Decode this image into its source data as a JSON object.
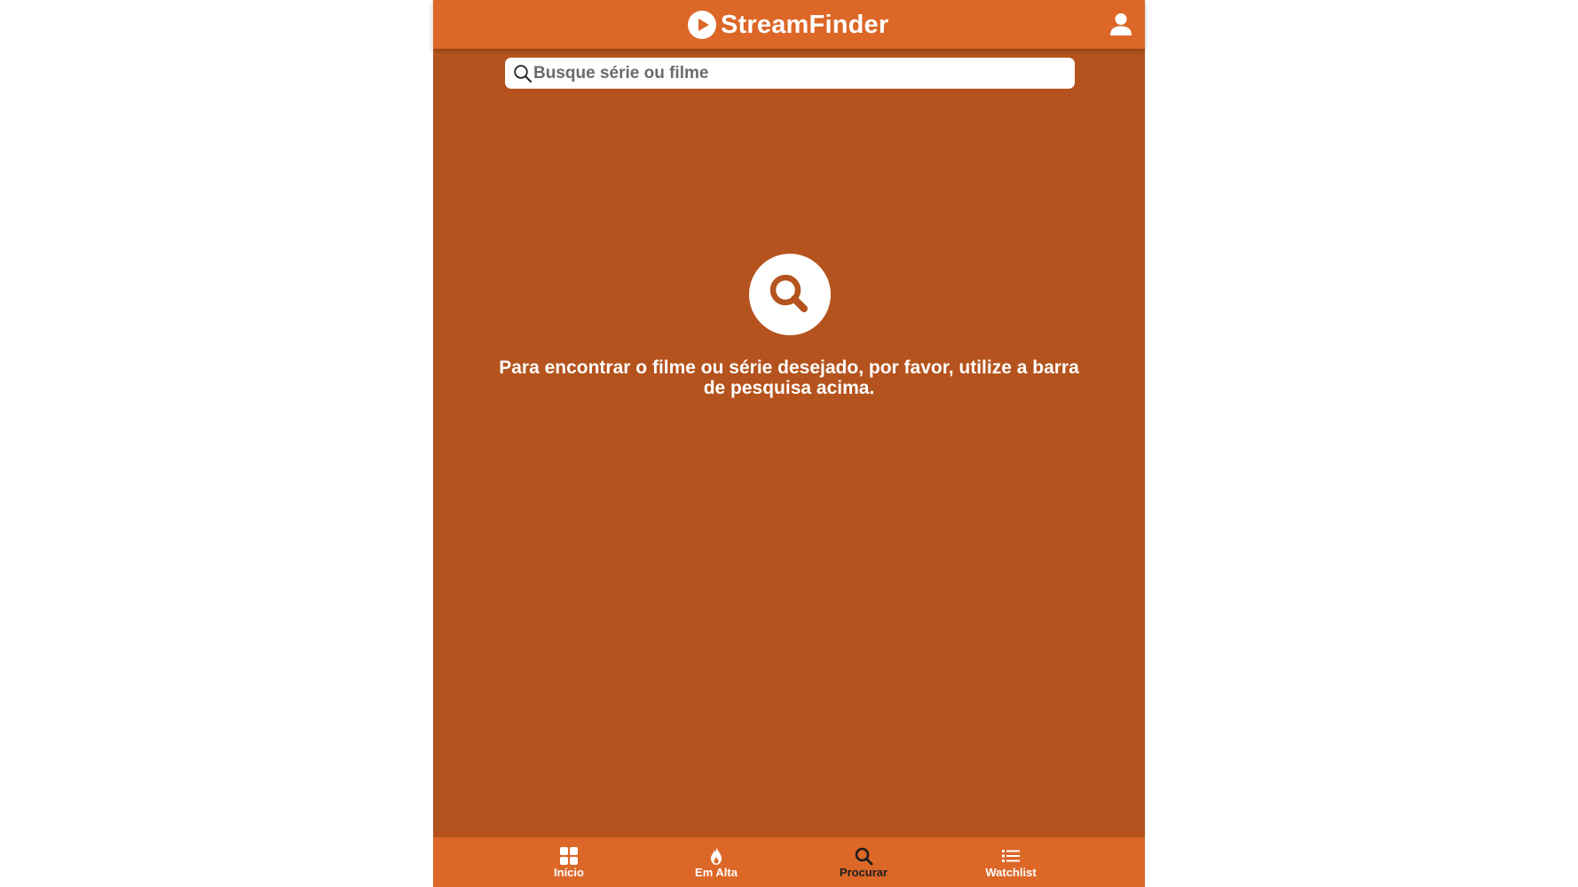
{
  "header": {
    "app_name": "StreamFinder",
    "logo_icon": "play-circle-icon",
    "user_icon": "user-icon"
  },
  "search": {
    "placeholder": "Busque série ou filme",
    "value": "",
    "icon": "search-icon"
  },
  "empty_state": {
    "icon": "magnifier-icon",
    "message": "Para encontrar o filme ou série desejado, por favor, utilize a barra de pesquisa acima."
  },
  "bottom_nav": {
    "active": "Procurar",
    "items": [
      {
        "label": "Início",
        "icon": "grid-icon"
      },
      {
        "label": "Em Alta",
        "icon": "flame-icon"
      },
      {
        "label": "Procurar",
        "icon": "search-icon"
      },
      {
        "label": "Watchlist",
        "icon": "list-icon"
      }
    ]
  },
  "colors": {
    "header": "#dc6727",
    "background": "#b4531d",
    "text": "#ffffff",
    "active_nav_label": "#1e1e1e"
  }
}
